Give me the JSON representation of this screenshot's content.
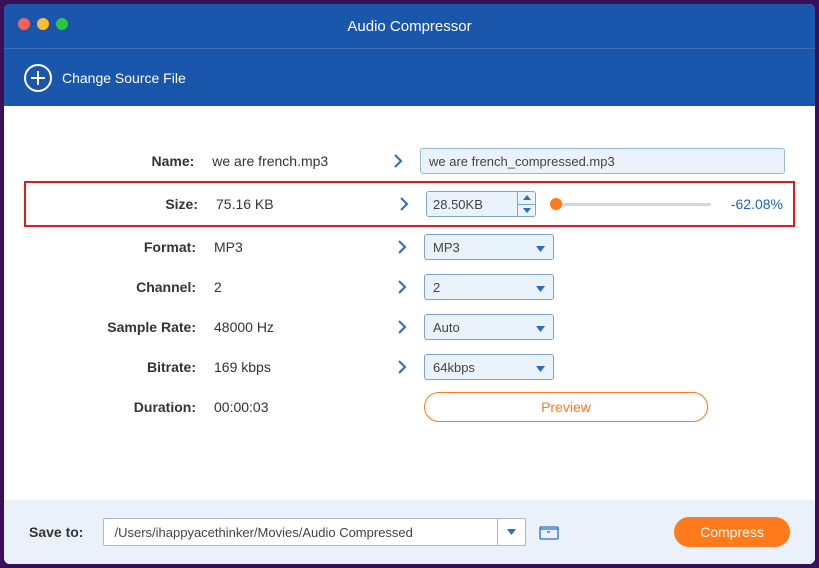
{
  "window": {
    "title": "Audio Compressor"
  },
  "toolbar": {
    "change_source_label": "Change Source File"
  },
  "labels": {
    "name": "Name:",
    "size": "Size:",
    "format": "Format:",
    "channel": "Channel:",
    "sample_rate": "Sample Rate:",
    "bitrate": "Bitrate:",
    "duration": "Duration:"
  },
  "source": {
    "name": "we are french.mp3",
    "size": "75.16 KB",
    "format": "MP3",
    "channel": "2",
    "sample_rate": "48000 Hz",
    "bitrate": "169 kbps",
    "duration": "00:00:03"
  },
  "target": {
    "name": "we are french_compressed.mp3",
    "size": "28.50KB",
    "size_percent": "-62.08%",
    "format": "MP3",
    "channel": "2",
    "sample_rate": "Auto",
    "bitrate": "64kbps"
  },
  "actions": {
    "preview": "Preview",
    "compress": "Compress"
  },
  "footer": {
    "saveto_label": "Save to:",
    "path": "/Users/ihappyacethinker/Movies/Audio Compressed"
  }
}
